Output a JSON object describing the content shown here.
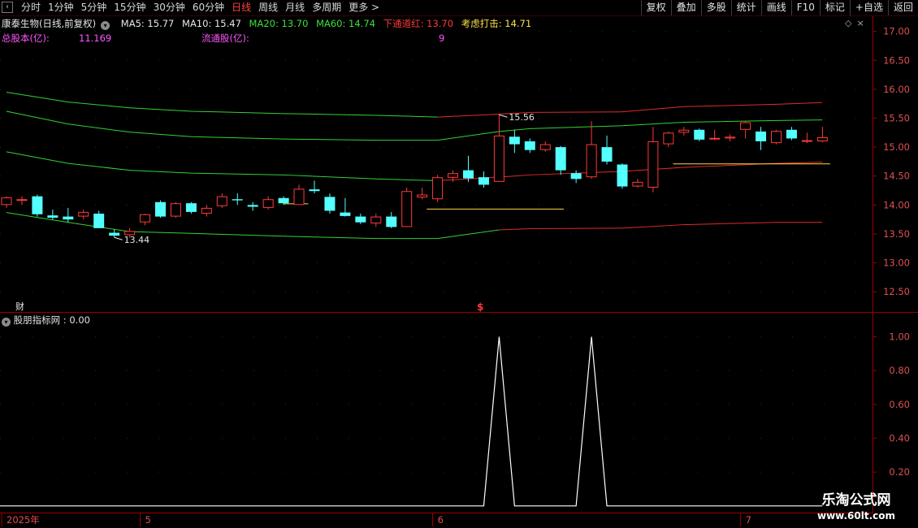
{
  "toolbar": {
    "back_icon": "‹",
    "period_tabs": [
      "分时",
      "1分钟",
      "5分钟",
      "15分钟",
      "30分钟",
      "60分钟",
      "日线",
      "周线",
      "月线",
      "多周期",
      "更多 >"
    ],
    "active_tab": "日线",
    "right_buttons": [
      "复权",
      "叠加",
      "多股",
      "统计",
      "画线",
      "F10",
      "标记",
      "+自选",
      "返回"
    ]
  },
  "header": {
    "stock_title": "康泰生物(日线,前复权)",
    "ma5": "MA5: 15.77",
    "ma10": "MA10: 15.47",
    "ma20": "MA20: 13.70",
    "ma60": "MA60: 14.74",
    "lower_band": "下通道红: 13.70",
    "consider": "考虑打击: 14.71",
    "total_shares_label": "总股本(亿):",
    "total_shares_value": "11.169",
    "float_shares_label": "流通股(亿):",
    "float_shares_value": "9"
  },
  "indicator": {
    "name": "股朋指标网 : 0.00"
  },
  "markers": {
    "finance": "财",
    "dollar": "$"
  },
  "watermark": {
    "title": "乐淘公式网",
    "url": "www.60lt.com"
  },
  "colors": {
    "up": "#ff3a3a",
    "down": "#54ffff",
    "band_green": "#32d232",
    "band_red": "#e02a2a",
    "yellow_line": "#ffd84a",
    "axis": "#9b0000"
  },
  "chart_data": [
    {
      "type": "candlestick",
      "y_axis_ticks": [
        17.0,
        16.5,
        16.0,
        15.5,
        15.0,
        14.5,
        14.0,
        13.5,
        13.0,
        12.5
      ],
      "ylim": [
        12.32,
        17.15
      ],
      "x_axis_labels": [
        {
          "label": "2025年",
          "index": 0
        },
        {
          "label": "5",
          "index": 9
        },
        {
          "label": "6",
          "index": 28
        },
        {
          "label": "7",
          "index": 48
        }
      ],
      "candles": [
        {
          "o": 14.0,
          "h": 14.15,
          "l": 13.95,
          "c": 14.13
        },
        {
          "o": 14.08,
          "h": 14.15,
          "l": 14.0,
          "c": 14.1
        },
        {
          "o": 14.15,
          "h": 14.18,
          "l": 13.8,
          "c": 13.84
        },
        {
          "o": 13.82,
          "h": 13.92,
          "l": 13.75,
          "c": 13.78
        },
        {
          "o": 13.8,
          "h": 13.95,
          "l": 13.7,
          "c": 13.75
        },
        {
          "o": 13.8,
          "h": 13.92,
          "l": 13.75,
          "c": 13.88
        },
        {
          "o": 13.85,
          "h": 13.9,
          "l": 13.6,
          "c": 13.6
        },
        {
          "o": 13.52,
          "h": 13.58,
          "l": 13.44,
          "c": 13.47
        },
        {
          "o": 13.48,
          "h": 13.6,
          "l": 13.44,
          "c": 13.55
        },
        {
          "o": 13.7,
          "h": 13.85,
          "l": 13.65,
          "c": 13.84
        },
        {
          "o": 14.05,
          "h": 14.08,
          "l": 13.78,
          "c": 13.8
        },
        {
          "o": 13.8,
          "h": 14.05,
          "l": 13.78,
          "c": 14.03
        },
        {
          "o": 14.03,
          "h": 14.05,
          "l": 13.85,
          "c": 13.88
        },
        {
          "o": 13.85,
          "h": 14.0,
          "l": 13.8,
          "c": 13.95
        },
        {
          "o": 13.98,
          "h": 14.2,
          "l": 13.95,
          "c": 14.15
        },
        {
          "o": 14.1,
          "h": 14.2,
          "l": 14.0,
          "c": 14.08
        },
        {
          "o": 14.0,
          "h": 14.05,
          "l": 13.9,
          "c": 13.97
        },
        {
          "o": 13.95,
          "h": 14.15,
          "l": 13.92,
          "c": 14.1
        },
        {
          "o": 14.12,
          "h": 14.15,
          "l": 14.0,
          "c": 14.03
        },
        {
          "o": 14.0,
          "h": 14.35,
          "l": 14.0,
          "c": 14.28
        },
        {
          "o": 14.27,
          "h": 14.42,
          "l": 14.2,
          "c": 14.24
        },
        {
          "o": 14.14,
          "h": 14.2,
          "l": 13.85,
          "c": 13.9
        },
        {
          "o": 13.87,
          "h": 14.12,
          "l": 13.8,
          "c": 13.81
        },
        {
          "o": 13.8,
          "h": 13.85,
          "l": 13.67,
          "c": 13.7
        },
        {
          "o": 13.68,
          "h": 13.85,
          "l": 13.62,
          "c": 13.8
        },
        {
          "o": 13.8,
          "h": 13.88,
          "l": 13.6,
          "c": 13.62
        },
        {
          "o": 13.62,
          "h": 14.3,
          "l": 13.62,
          "c": 14.24
        },
        {
          "o": 14.13,
          "h": 14.3,
          "l": 14.1,
          "c": 14.18
        },
        {
          "o": 14.1,
          "h": 14.52,
          "l": 14.05,
          "c": 14.48
        },
        {
          "o": 14.47,
          "h": 14.6,
          "l": 14.4,
          "c": 14.55
        },
        {
          "o": 14.6,
          "h": 14.85,
          "l": 14.4,
          "c": 14.46
        },
        {
          "o": 14.48,
          "h": 14.58,
          "l": 14.3,
          "c": 14.35
        },
        {
          "o": 14.4,
          "h": 15.56,
          "l": 14.4,
          "c": 15.2
        },
        {
          "o": 15.18,
          "h": 15.3,
          "l": 14.9,
          "c": 15.05
        },
        {
          "o": 15.1,
          "h": 15.15,
          "l": 14.9,
          "c": 14.95
        },
        {
          "o": 14.95,
          "h": 15.1,
          "l": 14.92,
          "c": 15.05
        },
        {
          "o": 15.0,
          "h": 15.02,
          "l": 14.52,
          "c": 14.6
        },
        {
          "o": 14.55,
          "h": 14.6,
          "l": 14.38,
          "c": 14.45
        },
        {
          "o": 14.48,
          "h": 15.45,
          "l": 14.45,
          "c": 15.05
        },
        {
          "o": 15.0,
          "h": 15.2,
          "l": 14.7,
          "c": 14.75
        },
        {
          "o": 14.7,
          "h": 14.72,
          "l": 14.28,
          "c": 14.32
        },
        {
          "o": 14.32,
          "h": 14.45,
          "l": 14.3,
          "c": 14.4
        },
        {
          "o": 14.3,
          "h": 15.35,
          "l": 14.22,
          "c": 15.1
        },
        {
          "o": 15.05,
          "h": 15.27,
          "l": 15.0,
          "c": 15.25
        },
        {
          "o": 15.25,
          "h": 15.35,
          "l": 15.2,
          "c": 15.3
        },
        {
          "o": 15.3,
          "h": 15.32,
          "l": 15.1,
          "c": 15.13
        },
        {
          "o": 15.15,
          "h": 15.3,
          "l": 15.12,
          "c": 15.16
        },
        {
          "o": 15.15,
          "h": 15.22,
          "l": 15.1,
          "c": 15.18
        },
        {
          "o": 15.3,
          "h": 15.45,
          "l": 15.15,
          "c": 15.43
        },
        {
          "o": 15.27,
          "h": 15.35,
          "l": 14.95,
          "c": 15.1
        },
        {
          "o": 15.07,
          "h": 15.3,
          "l": 15.05,
          "c": 15.28
        },
        {
          "o": 15.3,
          "h": 15.35,
          "l": 15.12,
          "c": 15.15
        },
        {
          "o": 15.1,
          "h": 15.25,
          "l": 15.07,
          "c": 15.12
        },
        {
          "o": 15.1,
          "h": 15.35,
          "l": 15.08,
          "c": 15.17
        }
      ],
      "upper_outer_band": [
        {
          "i": 0,
          "v": 15.95
        },
        {
          "i": 4,
          "v": 15.78
        },
        {
          "i": 8,
          "v": 15.68
        },
        {
          "i": 12,
          "v": 15.62
        },
        {
          "i": 18,
          "v": 15.58
        },
        {
          "i": 24,
          "v": 15.55
        },
        {
          "i": 28,
          "v": 15.52
        },
        {
          "i": 32,
          "v": 15.57
        },
        {
          "i": 34,
          "v": 15.6
        },
        {
          "i": 40,
          "v": 15.61
        },
        {
          "i": 44,
          "v": 15.7
        },
        {
          "i": 50,
          "v": 15.74
        },
        {
          "i": 53,
          "v": 15.77
        }
      ],
      "upper_inner_band": [
        {
          "i": 0,
          "v": 15.62
        },
        {
          "i": 4,
          "v": 15.4
        },
        {
          "i": 8,
          "v": 15.26
        },
        {
          "i": 12,
          "v": 15.18
        },
        {
          "i": 18,
          "v": 15.14
        },
        {
          "i": 24,
          "v": 15.12
        },
        {
          "i": 28,
          "v": 15.12
        },
        {
          "i": 32,
          "v": 15.27
        },
        {
          "i": 34,
          "v": 15.32
        },
        {
          "i": 40,
          "v": 15.37
        },
        {
          "i": 44,
          "v": 15.43
        },
        {
          "i": 50,
          "v": 15.46
        },
        {
          "i": 53,
          "v": 15.47
        }
      ],
      "mid_band": [
        {
          "i": 0,
          "v": 14.92
        },
        {
          "i": 4,
          "v": 14.72
        },
        {
          "i": 8,
          "v": 14.6
        },
        {
          "i": 12,
          "v": 14.55
        },
        {
          "i": 18,
          "v": 14.52
        },
        {
          "i": 24,
          "v": 14.45
        },
        {
          "i": 28,
          "v": 14.42
        },
        {
          "i": 32,
          "v": 14.48
        },
        {
          "i": 34,
          "v": 14.52
        },
        {
          "i": 40,
          "v": 14.58
        },
        {
          "i": 44,
          "v": 14.65
        },
        {
          "i": 50,
          "v": 14.72
        },
        {
          "i": 53,
          "v": 14.74
        }
      ],
      "lower_band": [
        {
          "i": 0,
          "v": 13.87
        },
        {
          "i": 4,
          "v": 13.7
        },
        {
          "i": 8,
          "v": 13.54
        },
        {
          "i": 12,
          "v": 13.51
        },
        {
          "i": 18,
          "v": 13.46
        },
        {
          "i": 24,
          "v": 13.42
        },
        {
          "i": 28,
          "v": 13.42
        },
        {
          "i": 32,
          "v": 13.57
        },
        {
          "i": 34,
          "v": 13.59
        },
        {
          "i": 40,
          "v": 13.6
        },
        {
          "i": 44,
          "v": 13.66
        },
        {
          "i": 50,
          "v": 13.7
        },
        {
          "i": 53,
          "v": 13.7
        }
      ],
      "yellow_lines": [
        {
          "from": 18,
          "to": 19.6,
          "v": 14.02
        },
        {
          "from": 27.3,
          "to": 36.2,
          "v": 13.93
        },
        {
          "from": 43.3,
          "to": 53.5,
          "v": 14.71
        }
      ],
      "annotations": [
        {
          "label": "15.56",
          "index": 32,
          "value": 15.56
        },
        {
          "label": "13.44",
          "index": 7,
          "value": 13.44
        }
      ]
    },
    {
      "type": "line",
      "name": "股朋指标网",
      "y_axis_ticks": [
        1.0,
        0.8,
        0.6,
        0.4,
        0.2
      ],
      "ylim": [
        -0.02,
        1.07
      ],
      "values": [
        0,
        0,
        0,
        0,
        0,
        0,
        0,
        0,
        0,
        0,
        0,
        0,
        0,
        0,
        0,
        0,
        0,
        0,
        0,
        0,
        0,
        0,
        0,
        0,
        0,
        0,
        0,
        0,
        0,
        0,
        0,
        0,
        1,
        0,
        0,
        0,
        0,
        0,
        1,
        0,
        0,
        0,
        0,
        0,
        0,
        0,
        0,
        0,
        0,
        0,
        0,
        0,
        0,
        0
      ]
    }
  ]
}
